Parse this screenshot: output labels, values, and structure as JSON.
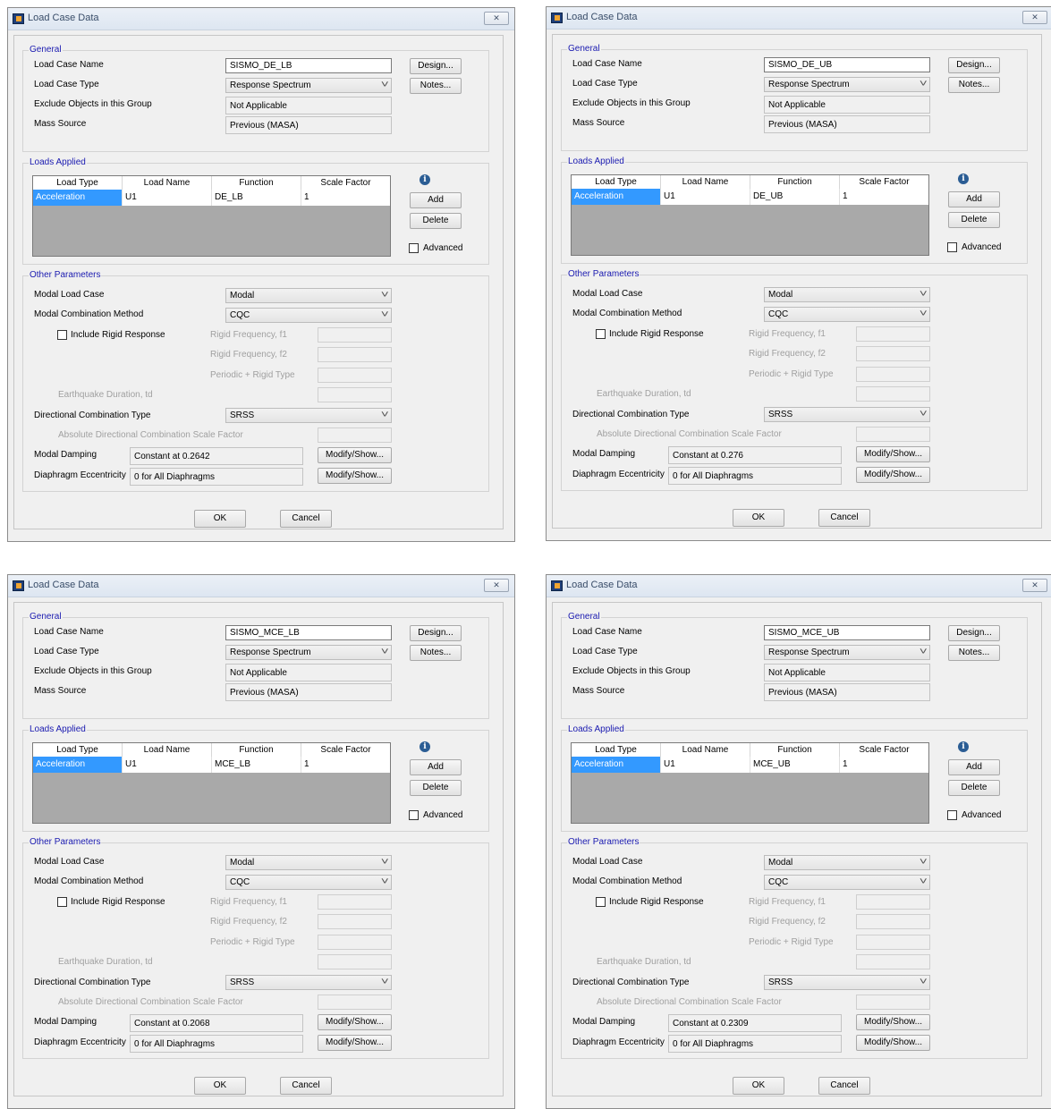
{
  "common": {
    "window_title": "Load Case Data",
    "close_glyph": "✕",
    "chevron": "˅",
    "info_glyph": "i",
    "general": {
      "title": "General",
      "load_case_name_label": "Load Case Name",
      "load_case_type_label": "Load Case Type",
      "exclude_label": "Exclude Objects in this Group",
      "mass_source_label": "Mass Source",
      "load_case_type_value": "Response Spectrum",
      "exclude_value": "Not Applicable",
      "mass_source_value": "Previous  (MASA)",
      "design_button": "Design...",
      "notes_button": "Notes..."
    },
    "loads": {
      "title": "Loads Applied",
      "headers": [
        "Load Type",
        "Load Name",
        "Function",
        "Scale Factor"
      ],
      "load_type": "Acceleration",
      "load_name": "U1",
      "scale_factor": "1",
      "add_button": "Add",
      "delete_button": "Delete",
      "advanced_label": "Advanced"
    },
    "other": {
      "title": "Other Parameters",
      "modal_load_case_label": "Modal Load Case",
      "modal_load_case_value": "Modal",
      "modal_combination_label": "Modal Combination Method",
      "modal_combination_value": "CQC",
      "include_rigid_label": "Include Rigid Response",
      "rigid_f1_label": "Rigid Frequency, f1",
      "rigid_f2_label": "Rigid Frequency, f2",
      "periodic_label": "Periodic + Rigid Type",
      "eq_duration_label": "Earthquake Duration, td",
      "directional_label": "Directional Combination Type",
      "directional_value": "SRSS",
      "abs_directional_label": "Absolute Directional Combination Scale Factor",
      "modal_damping_label": "Modal Damping",
      "diaphragm_label": "Diaphragm Eccentricity",
      "diaphragm_value": "0 for All Diaphragms",
      "modify_button": "Modify/Show..."
    },
    "ok_button": "OK",
    "cancel_button": "Cancel"
  },
  "dialogs": [
    {
      "load_case_name": "SISMO_DE_LB",
      "function": "DE_LB",
      "modal_damping": "Constant at 0.2642"
    },
    {
      "load_case_name": "SISMO_DE_UB",
      "function": "DE_UB",
      "modal_damping": "Constant at 0.276"
    },
    {
      "load_case_name": "SISMO_MCE_LB",
      "function": "MCE_LB",
      "modal_damping": "Constant at 0.2068"
    },
    {
      "load_case_name": "SISMO_MCE_UB",
      "function": "MCE_UB",
      "modal_damping": "Constant at 0.2309"
    }
  ]
}
